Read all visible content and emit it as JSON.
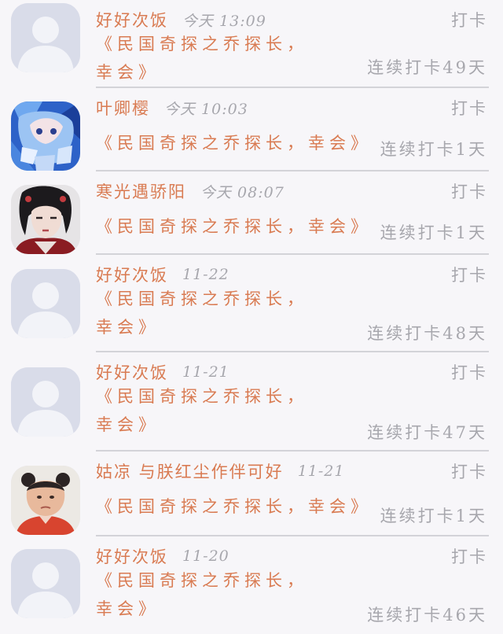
{
  "check_in_label": "打卡",
  "colors": {
    "username": "#d97b52",
    "message": "#d97b52",
    "meta_gray": "#a7a7ad",
    "divider": "#d3d3d8",
    "background": "#f7f6f9"
  },
  "entries": [
    {
      "username": "好好次饭",
      "time": "今天 13:09",
      "message": "《民国奇探之乔探长，幸会》",
      "streak": "连续打卡49天",
      "avatar": "default-avatar-icon"
    },
    {
      "username": "叶卿樱",
      "time": "今天 10:03",
      "message": "《民国奇探之乔探长，幸会》",
      "streak": "连续打卡1天",
      "avatar": "anime-girl-avatar"
    },
    {
      "username": "寒光遇骄阳",
      "time": "今天 08:07",
      "message": "《民国奇探之乔探长，幸会》",
      "streak": "连续打卡1天",
      "avatar": "costume-actor-avatar"
    },
    {
      "username": "好好次饭",
      "time": "11-22",
      "message": "《民国奇探之乔探长，幸会》",
      "streak": "连续打卡48天",
      "avatar": "default-avatar-icon"
    },
    {
      "username": "好好次饭",
      "time": "11-21",
      "message": "《民国奇探之乔探长，幸会》",
      "streak": "连续打卡47天",
      "avatar": "default-avatar-icon"
    },
    {
      "username": "姑凉 与朕红尘作伴可好",
      "time": "11-21",
      "message": "《民国奇探之乔探长，幸会》",
      "streak": "连续打卡1天",
      "avatar": "child-photo-avatar"
    },
    {
      "username": "好好次饭",
      "time": "11-20",
      "message": "《民国奇探之乔探长，幸会》",
      "streak": "连续打卡46天",
      "avatar": "default-avatar-icon"
    }
  ]
}
